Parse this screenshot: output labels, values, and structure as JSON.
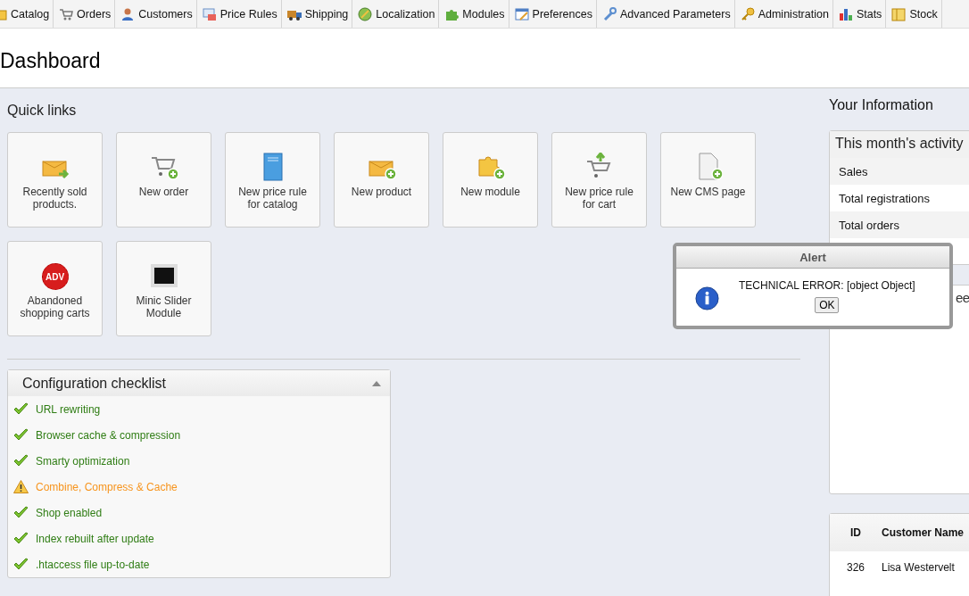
{
  "menu": [
    {
      "label": "Catalog"
    },
    {
      "label": "Orders"
    },
    {
      "label": "Customers"
    },
    {
      "label": "Price Rules"
    },
    {
      "label": "Shipping"
    },
    {
      "label": "Localization"
    },
    {
      "label": "Modules"
    },
    {
      "label": "Preferences"
    },
    {
      "label": "Advanced Parameters"
    },
    {
      "label": "Administration"
    },
    {
      "label": "Stats"
    },
    {
      "label": "Stock"
    }
  ],
  "page_title": "Dashboard",
  "quick_links": {
    "title": "Quick links",
    "items": [
      {
        "label": "Recently sold products."
      },
      {
        "label": "New order"
      },
      {
        "label": "New price rule for catalog"
      },
      {
        "label": "New product"
      },
      {
        "label": "New module"
      },
      {
        "label": "New price rule for cart"
      },
      {
        "label": "New CMS page"
      },
      {
        "label": "Abandoned shopping carts",
        "badge": "ADV"
      },
      {
        "label": "Minic Slider Module"
      }
    ]
  },
  "checklist": {
    "title": "Configuration checklist",
    "items": [
      {
        "label": "URL rewriting",
        "kind": "ok"
      },
      {
        "label": "Browser cache & compression",
        "kind": "ok"
      },
      {
        "label": "Smarty optimization",
        "kind": "ok"
      },
      {
        "label": "Combine, Compress & Cache",
        "kind": "warning"
      },
      {
        "label": "Shop enabled",
        "kind": "ok"
      },
      {
        "label": "Index rebuilt after update",
        "kind": "ok"
      },
      {
        "label": ".htaccess file up-to-date",
        "kind": "ok"
      }
    ]
  },
  "your_information": {
    "title": "Your Information",
    "activity": {
      "title": "This month's activity",
      "rows": [
        "Sales",
        "Total registrations",
        "Total orders"
      ]
    },
    "chart_panel": {
      "title": "ee"
    },
    "customers_table": {
      "columns": [
        "ID",
        "Customer Name"
      ],
      "rows": [
        [
          "326",
          "Lisa Westervelt"
        ]
      ]
    }
  },
  "alert": {
    "title": "Alert",
    "message": "TECHNICAL ERROR: [object Object]",
    "button": "OK"
  }
}
